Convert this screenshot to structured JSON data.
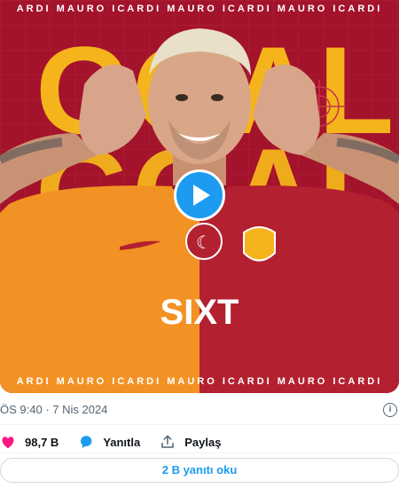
{
  "media": {
    "marquee_text": "ARDI  MAURO  ICARDI  MAURO  ICARDI  MAURO  ICARDI",
    "headline": "GOAL!",
    "sponsor": "SIXT",
    "colors": {
      "background": "#a3132b",
      "headline": "#f5b41c",
      "jersey_orange": "#f39224",
      "jersey_red": "#b3202f"
    }
  },
  "tweet": {
    "time": "ÖS 9:40",
    "separator": " · ",
    "date": "7 Nis 2024"
  },
  "actions": {
    "likes_count": "98,7 B",
    "reply_label": "Yanıtla",
    "share_label": "Paylaş"
  },
  "replies": {
    "button_label": "2 B yanıtı oku"
  },
  "icons": {
    "info": "info-icon",
    "like": "heart-icon",
    "reply": "reply-bubble-icon",
    "share": "share-icon",
    "play": "play-icon"
  },
  "accent_color": "#1d9bf0",
  "like_color": "#f91880"
}
